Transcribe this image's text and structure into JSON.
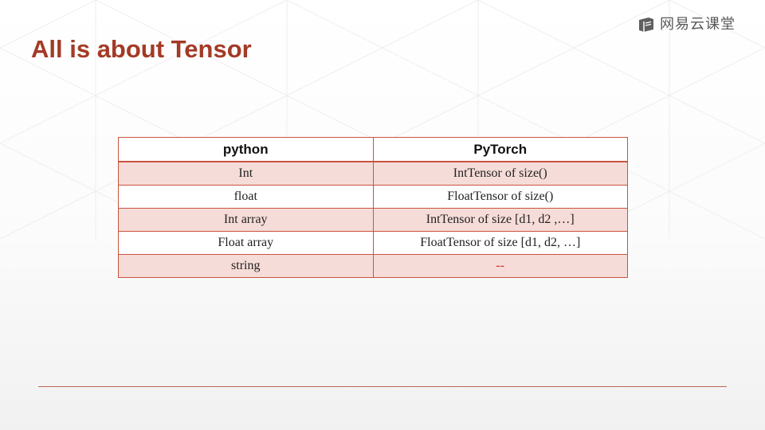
{
  "brand": {
    "name": "网易云课堂",
    "icon": "netease-cloud-classroom-icon"
  },
  "slide": {
    "title": "All is about Tensor"
  },
  "table": {
    "headers": [
      "python",
      "PyTorch"
    ],
    "rows": [
      [
        "Int",
        "IntTensor of size()"
      ],
      [
        "float",
        "FloatTensor of size()"
      ],
      [
        "Int array",
        "IntTensor of size [d1, d2 ,…]"
      ],
      [
        "Float array",
        "FloatTensor of size [d1, d2, …]"
      ],
      [
        "string",
        "--"
      ]
    ]
  },
  "colors": {
    "title": "#a33a26",
    "table_border": "#c8543e",
    "row_tint": "#f6dcd8",
    "dash_text": "#d42b1e"
  }
}
